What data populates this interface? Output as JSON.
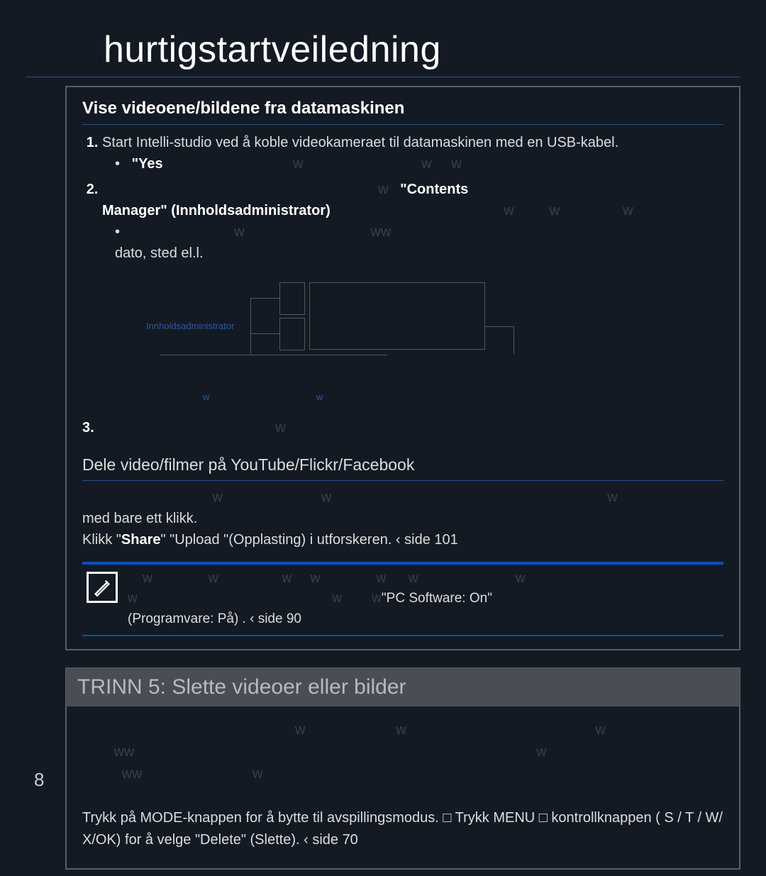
{
  "pageNumber": "8",
  "title": "hurtigstartveiledning",
  "section1": {
    "heading": "Vise videoene/bildene fra datamaskinen",
    "step1_pre": "Start Intelli-studio ved å koble videokameraet til datamaskinen med en USB-kabel.",
    "step1_bullet_yes": "\"Yes",
    "step2_contents": "\"Contents",
    "step2_manager": "Manager\" (Innholdsadministrator)",
    "step2_bullet_tail": "dato, sted el.l.",
    "diag_label": "Innholdsadministrator",
    "step3_marker": "3.",
    "subhead2": "Dele video/filmer på YouTube/Flickr/Facebook",
    "share_line1": "med bare ett klikk.",
    "share_line2_a": "Klikk \"",
    "share_line2_b": "Share",
    "share_line2_c": "\"     \"Upload \"(Opplasting)   i utforskeren.  ‹ side 101",
    "note_pc": "\"PC Software: On\"",
    "note_tail": "(Programvare: På)  .  ‹ side 90"
  },
  "section2": {
    "bar": "TRINN 5: Slette videoer eller bilder",
    "body": "Trykk på MODE-knappen for å bytte til avspillingsmodus.   □  Trykk MENU □ kontrollknappen (   S / T  /  W/  X/OK) for å velge \"Delete\" (Slette).    ‹ side 70"
  }
}
